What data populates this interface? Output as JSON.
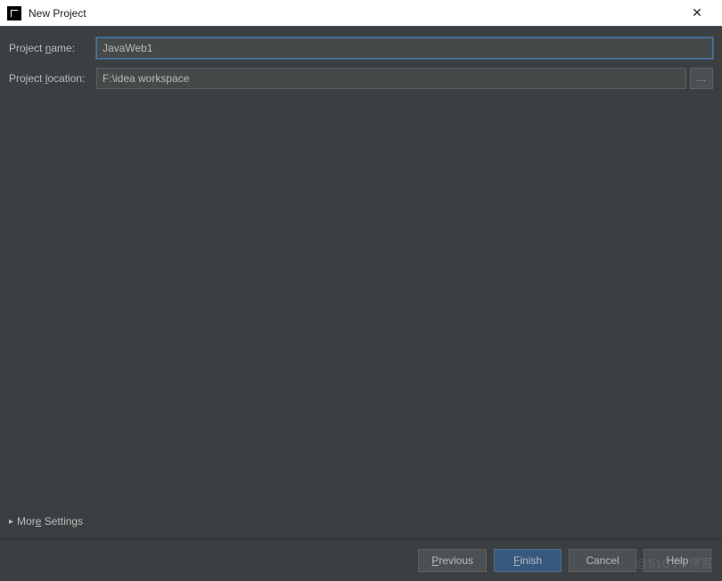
{
  "titlebar": {
    "title": "New Project",
    "close_icon": "✕"
  },
  "form": {
    "project_name": {
      "label_prefix": "Project ",
      "label_underline": "n",
      "label_suffix": "ame:",
      "value": "JavaWeb1"
    },
    "project_location": {
      "label_prefix": "Project ",
      "label_underline": "l",
      "label_suffix": "ocation:",
      "value": "F:\\idea workspace",
      "browse_label": "..."
    }
  },
  "more_settings": {
    "arrow": "▸",
    "label_prefix": "Mor",
    "label_underline": "e",
    "label_suffix": " Settings"
  },
  "buttons": {
    "previous_underline": "P",
    "previous_rest": "revious",
    "finish_underline": "F",
    "finish_rest": "inish",
    "cancel": "Cancel",
    "help": "Help"
  },
  "watermark": "@51CTO博客"
}
